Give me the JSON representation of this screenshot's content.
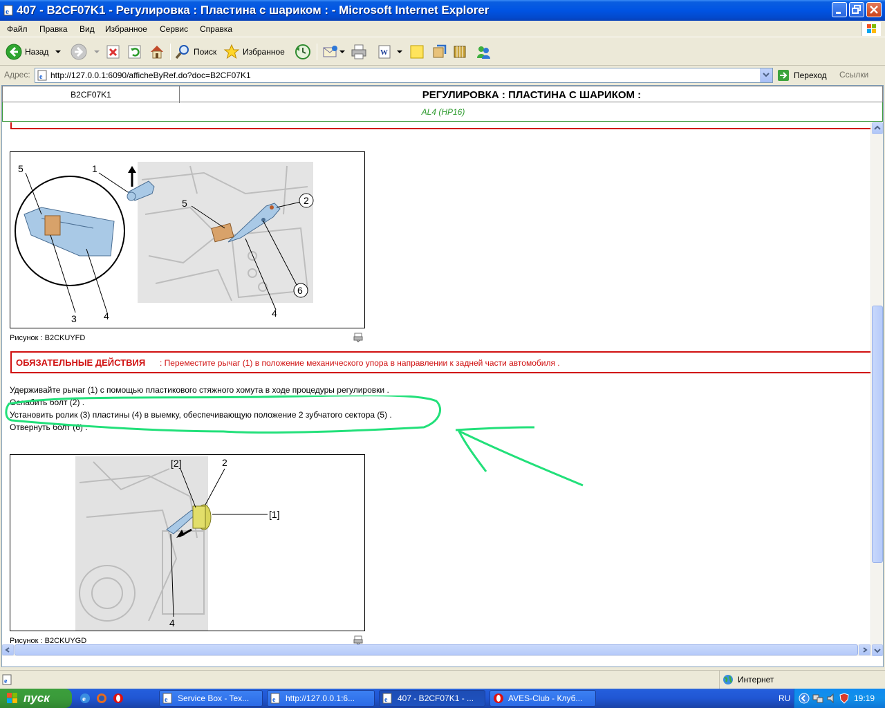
{
  "window": {
    "title": "407 - B2CF07K1 - Регулировка : Пластина с шариком : - Microsoft Internet Explorer"
  },
  "menu": [
    "Файл",
    "Правка",
    "Вид",
    "Избранное",
    "Сервис",
    "Справка"
  ],
  "toolbar": {
    "back_label": "Назад",
    "search_label": "Поиск",
    "favorites_label": "Избранное"
  },
  "address": {
    "label": "Адрес:",
    "url": "http://127.0.0.1:6090/afficheByRef.do?doc=B2CF07K1",
    "go_label": "Переход",
    "links_label": "Ссылки"
  },
  "doc_header": {
    "doc_id": "B2CF07K1",
    "title": "РЕГУЛИРОВКА : ПЛАСТИНА С ШАРИКОМ :",
    "model": "AL4 (HP16)"
  },
  "figure1": {
    "caption": "Рисунок : B2CKUYFD",
    "callouts": [
      "5",
      "1",
      "5",
      "2",
      "3",
      "4",
      "4",
      "6"
    ]
  },
  "mandatory": {
    "label": "ОБЯЗАТЕЛЬНЫЕ ДЕЙСТВИЯ",
    "text": " : Переместите рычаг (1) в положение механического упора в направлении к задней части автомобиля ."
  },
  "steps": [
    "Удерживайте рычаг (1) с помощью пластикового стяжного хомута в ходе процедуры регулировки .",
    "Ослабить болт (2) .",
    "Установить ролик (3) пластины (4) в выемку, обеспечивающую положение 2 зубчатого сектора (5) .",
    "Отвернуть болт (6) ."
  ],
  "figure2": {
    "caption": "Рисунок : B2CKUYGD",
    "callouts": [
      "[2]",
      "2",
      "[1]",
      "4"
    ]
  },
  "status": {
    "zone": "Интернет"
  },
  "taskbar": {
    "start": "пуск",
    "buttons": [
      "Service Box - Tex...",
      "http://127.0.0.1:6...",
      "407 - B2CF07K1 - ...",
      "AVES-Club - Клуб..."
    ],
    "lang": "RU",
    "clock": "19:19"
  },
  "colors": {
    "red": "#D01010",
    "green_annotation": "#22E07A",
    "model_green": "#2E9B2E"
  }
}
